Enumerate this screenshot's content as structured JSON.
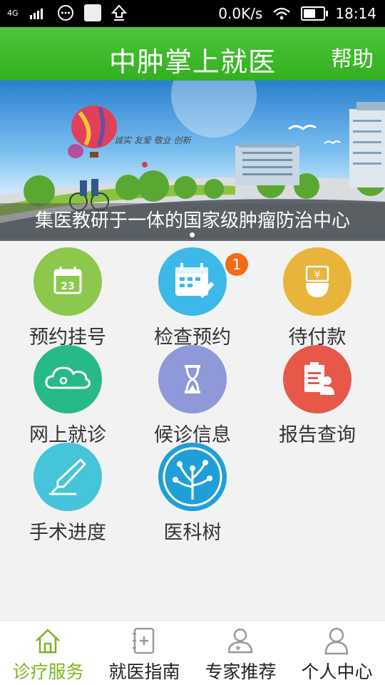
{
  "status_bar": {
    "network": "4G",
    "speed": "0.0K/s",
    "time": "18:14",
    "battery_level": 0.6
  },
  "header": {
    "title": "中肿掌上就医",
    "help_label": "帮助"
  },
  "banner": {
    "caption": "集医教研于一体的国家级肿瘤防治中心",
    "slogan": "诚实 友爱 敬业 创新"
  },
  "menu": [
    {
      "label": "预约挂号",
      "icon": "calendar-23-icon",
      "color": "#8cc84b",
      "icon_text": "23"
    },
    {
      "label": "检查预约",
      "icon": "calendar-check-icon",
      "color": "#3cb9e8",
      "badge": "1"
    },
    {
      "label": "待付款",
      "icon": "payment-hand-icon",
      "color": "#e8b43a",
      "icon_text": "¥"
    },
    {
      "label": "网上就诊",
      "icon": "cloud-icon",
      "color": "#27b98a"
    },
    {
      "label": "候诊信息",
      "icon": "hourglass-icon",
      "color": "#8f98d8"
    },
    {
      "label": "报告查询",
      "icon": "report-icon",
      "color": "#e8584a"
    },
    {
      "label": "手术进度",
      "icon": "scalpel-icon",
      "color": "#45c4da"
    },
    {
      "label": "医科树",
      "icon": "tree-logo-icon",
      "color": "#1f9fd8"
    }
  ],
  "tabbar": [
    {
      "label": "诊疗服务",
      "icon": "home-icon",
      "active": true
    },
    {
      "label": "就医指南",
      "icon": "guide-book-icon"
    },
    {
      "label": "专家推荐",
      "icon": "doctor-icon"
    },
    {
      "label": "个人中心",
      "icon": "user-icon"
    }
  ],
  "colors": {
    "header": "#3cb82a",
    "active_tab": "#7ab61f",
    "badge": "#f36b16"
  }
}
